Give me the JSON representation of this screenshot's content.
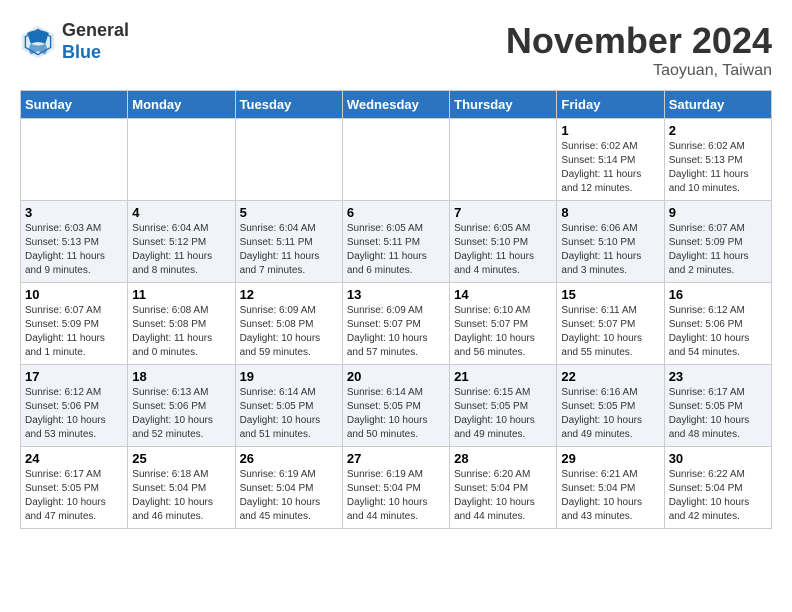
{
  "header": {
    "logo_line1": "General",
    "logo_line2": "Blue",
    "month": "November 2024",
    "location": "Taoyuan, Taiwan"
  },
  "weekdays": [
    "Sunday",
    "Monday",
    "Tuesday",
    "Wednesday",
    "Thursday",
    "Friday",
    "Saturday"
  ],
  "weeks": [
    [
      {
        "day": "",
        "info": ""
      },
      {
        "day": "",
        "info": ""
      },
      {
        "day": "",
        "info": ""
      },
      {
        "day": "",
        "info": ""
      },
      {
        "day": "",
        "info": ""
      },
      {
        "day": "1",
        "info": "Sunrise: 6:02 AM\nSunset: 5:14 PM\nDaylight: 11 hours and 12 minutes."
      },
      {
        "day": "2",
        "info": "Sunrise: 6:02 AM\nSunset: 5:13 PM\nDaylight: 11 hours and 10 minutes."
      }
    ],
    [
      {
        "day": "3",
        "info": "Sunrise: 6:03 AM\nSunset: 5:13 PM\nDaylight: 11 hours and 9 minutes."
      },
      {
        "day": "4",
        "info": "Sunrise: 6:04 AM\nSunset: 5:12 PM\nDaylight: 11 hours and 8 minutes."
      },
      {
        "day": "5",
        "info": "Sunrise: 6:04 AM\nSunset: 5:11 PM\nDaylight: 11 hours and 7 minutes."
      },
      {
        "day": "6",
        "info": "Sunrise: 6:05 AM\nSunset: 5:11 PM\nDaylight: 11 hours and 6 minutes."
      },
      {
        "day": "7",
        "info": "Sunrise: 6:05 AM\nSunset: 5:10 PM\nDaylight: 11 hours and 4 minutes."
      },
      {
        "day": "8",
        "info": "Sunrise: 6:06 AM\nSunset: 5:10 PM\nDaylight: 11 hours and 3 minutes."
      },
      {
        "day": "9",
        "info": "Sunrise: 6:07 AM\nSunset: 5:09 PM\nDaylight: 11 hours and 2 minutes."
      }
    ],
    [
      {
        "day": "10",
        "info": "Sunrise: 6:07 AM\nSunset: 5:09 PM\nDaylight: 11 hours and 1 minute."
      },
      {
        "day": "11",
        "info": "Sunrise: 6:08 AM\nSunset: 5:08 PM\nDaylight: 11 hours and 0 minutes."
      },
      {
        "day": "12",
        "info": "Sunrise: 6:09 AM\nSunset: 5:08 PM\nDaylight: 10 hours and 59 minutes."
      },
      {
        "day": "13",
        "info": "Sunrise: 6:09 AM\nSunset: 5:07 PM\nDaylight: 10 hours and 57 minutes."
      },
      {
        "day": "14",
        "info": "Sunrise: 6:10 AM\nSunset: 5:07 PM\nDaylight: 10 hours and 56 minutes."
      },
      {
        "day": "15",
        "info": "Sunrise: 6:11 AM\nSunset: 5:07 PM\nDaylight: 10 hours and 55 minutes."
      },
      {
        "day": "16",
        "info": "Sunrise: 6:12 AM\nSunset: 5:06 PM\nDaylight: 10 hours and 54 minutes."
      }
    ],
    [
      {
        "day": "17",
        "info": "Sunrise: 6:12 AM\nSunset: 5:06 PM\nDaylight: 10 hours and 53 minutes."
      },
      {
        "day": "18",
        "info": "Sunrise: 6:13 AM\nSunset: 5:06 PM\nDaylight: 10 hours and 52 minutes."
      },
      {
        "day": "19",
        "info": "Sunrise: 6:14 AM\nSunset: 5:05 PM\nDaylight: 10 hours and 51 minutes."
      },
      {
        "day": "20",
        "info": "Sunrise: 6:14 AM\nSunset: 5:05 PM\nDaylight: 10 hours and 50 minutes."
      },
      {
        "day": "21",
        "info": "Sunrise: 6:15 AM\nSunset: 5:05 PM\nDaylight: 10 hours and 49 minutes."
      },
      {
        "day": "22",
        "info": "Sunrise: 6:16 AM\nSunset: 5:05 PM\nDaylight: 10 hours and 49 minutes."
      },
      {
        "day": "23",
        "info": "Sunrise: 6:17 AM\nSunset: 5:05 PM\nDaylight: 10 hours and 48 minutes."
      }
    ],
    [
      {
        "day": "24",
        "info": "Sunrise: 6:17 AM\nSunset: 5:05 PM\nDaylight: 10 hours and 47 minutes."
      },
      {
        "day": "25",
        "info": "Sunrise: 6:18 AM\nSunset: 5:04 PM\nDaylight: 10 hours and 46 minutes."
      },
      {
        "day": "26",
        "info": "Sunrise: 6:19 AM\nSunset: 5:04 PM\nDaylight: 10 hours and 45 minutes."
      },
      {
        "day": "27",
        "info": "Sunrise: 6:19 AM\nSunset: 5:04 PM\nDaylight: 10 hours and 44 minutes."
      },
      {
        "day": "28",
        "info": "Sunrise: 6:20 AM\nSunset: 5:04 PM\nDaylight: 10 hours and 44 minutes."
      },
      {
        "day": "29",
        "info": "Sunrise: 6:21 AM\nSunset: 5:04 PM\nDaylight: 10 hours and 43 minutes."
      },
      {
        "day": "30",
        "info": "Sunrise: 6:22 AM\nSunset: 5:04 PM\nDaylight: 10 hours and 42 minutes."
      }
    ]
  ]
}
